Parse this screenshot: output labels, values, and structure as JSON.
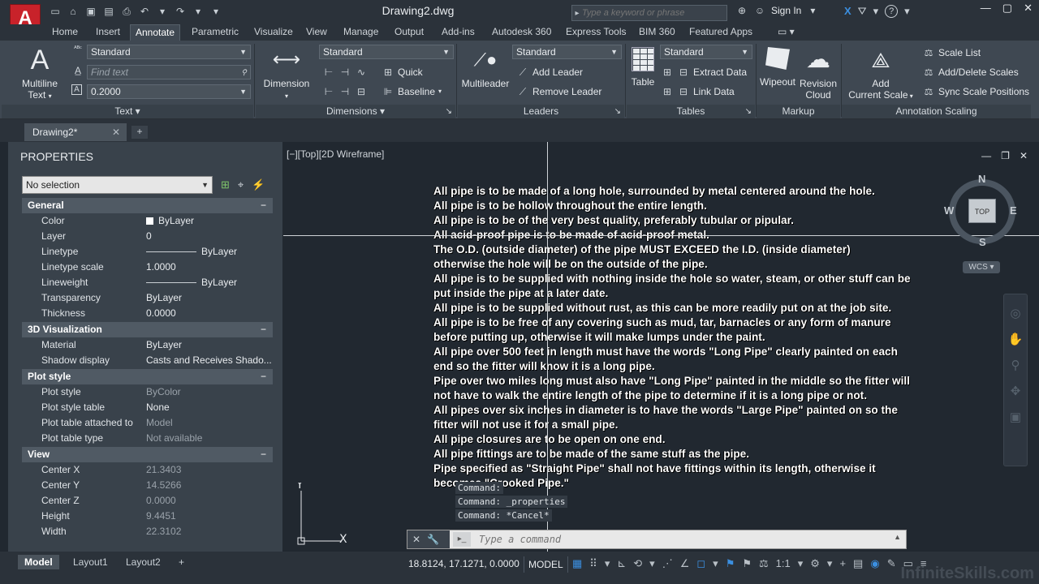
{
  "app": {
    "title": "Drawing2.dwg",
    "logo_letter": "A",
    "search_placeholder": "Type a keyword or phrase",
    "sign_in": "Sign In",
    "help": "?"
  },
  "ribbon_tabs": [
    "Home",
    "Insert",
    "Annotate",
    "Parametric",
    "Visualize",
    "View",
    "Manage",
    "Output",
    "Add-ins",
    "Autodesk 360",
    "Express Tools",
    "BIM 360",
    "Featured Apps"
  ],
  "active_tab": "Annotate",
  "ribbon": {
    "text": {
      "multiline_line1": "Multiline",
      "multiline_line2": "Text",
      "style": "Standard",
      "find_placeholder": "Find text",
      "height": "0.2000",
      "panel_title": "Text"
    },
    "dimensions": {
      "dimension": "Dimension",
      "style": "Standard",
      "quick": "Quick",
      "baseline": "Baseline",
      "panel_title": "Dimensions"
    },
    "leaders": {
      "multileader": "Multileader",
      "style": "Standard",
      "add_leader": "Add Leader",
      "remove_leader": "Remove Leader",
      "panel_title": "Leaders"
    },
    "tables": {
      "table": "Table",
      "style": "Standard",
      "extract_data": "Extract Data",
      "link_data": "Link Data",
      "panel_title": "Tables"
    },
    "markup": {
      "wipeout": "Wipeout",
      "revision_line1": "Revision",
      "revision_line2": "Cloud",
      "panel_title": "Markup"
    },
    "annotation_scaling": {
      "add_line1": "Add",
      "add_line2": "Current Scale",
      "scale_list": "Scale List",
      "add_delete_scales": "Add/Delete Scales",
      "sync_scale_positions": "Sync Scale Positions",
      "panel_title": "Annotation Scaling"
    }
  },
  "doc_tab": {
    "label": "Drawing2*"
  },
  "properties": {
    "title": "PROPERTIES",
    "selection": "No selection",
    "sections": {
      "general": "General",
      "viz3d": "3D Visualization",
      "plot": "Plot style",
      "view": "View"
    },
    "general": [
      {
        "k": "Color",
        "v": "ByLayer"
      },
      {
        "k": "Layer",
        "v": "0"
      },
      {
        "k": "Linetype",
        "v": "ByLayer"
      },
      {
        "k": "Linetype scale",
        "v": "1.0000"
      },
      {
        "k": "Lineweight",
        "v": "ByLayer"
      },
      {
        "k": "Transparency",
        "v": "ByLayer"
      },
      {
        "k": "Thickness",
        "v": "0.0000"
      }
    ],
    "viz3d": [
      {
        "k": "Material",
        "v": "ByLayer"
      },
      {
        "k": "Shadow display",
        "v": "Casts  and  Receives  Shado..."
      }
    ],
    "plot": [
      {
        "k": "Plot style",
        "v": "ByColor"
      },
      {
        "k": "Plot style table",
        "v": "None"
      },
      {
        "k": "Plot table attached to",
        "v": "Model"
      },
      {
        "k": "Plot table type",
        "v": "Not available"
      }
    ],
    "view": [
      {
        "k": "Center X",
        "v": "21.3403"
      },
      {
        "k": "Center Y",
        "v": "14.5266"
      },
      {
        "k": "Center Z",
        "v": "0.0000"
      },
      {
        "k": "Height",
        "v": "9.4451"
      },
      {
        "k": "Width",
        "v": "22.3102"
      }
    ]
  },
  "layout_tabs": [
    "Model",
    "Layout1",
    "Layout2"
  ],
  "viewport": {
    "label": "[−][Top][2D Wireframe]",
    "viewcube": {
      "n": "N",
      "s": "S",
      "e": "E",
      "w": "W",
      "top": "TOP"
    },
    "wcs": "WCS",
    "ucs_x": "X",
    "ucs_y": "Y"
  },
  "mtext_lines": [
    "All pipe is to be made of a long hole, surrounded by metal centered around the hole.",
    "All pipe is to be hollow throughout the entire length.",
    "All pipe is to be of the very best quality, preferably tubular or pipular.",
    "All acid-proof pipe is to be made of acid-proof metal.",
    "The O.D. (outside diameter) of the pipe MUST EXCEED the I.D. (inside diameter)",
    "otherwise the hole will be on the outside of the pipe.",
    "All pipe is to be supplied with nothing inside the hole so water, steam, or other stuff can be",
    "put inside the pipe at a later date.",
    "All pipe is to be supplied without rust, as this can be more readily put on at the job site.",
    "All pipe is to be free of any covering such as mud, tar, barnacles or any form of manure",
    "before putting up, otherwise it will make lumps under the paint.",
    "All pipe over 500 feet in length must have the words \"Long Pipe\" clearly painted on each",
    "end so the fitter will know it is a long pipe.",
    "Pipe over two miles long must also have \"Long Pipe\" painted in the middle so the fitter will",
    "not have to walk the entire length of the pipe to determine if it is a long pipe or not.",
    "All pipes over six inches in diameter is to have the words \"Large Pipe\" painted on so the",
    "fitter will not use it for a small pipe.",
    "All pipe closures are to be open on one end.",
    "All pipe fittings are to be made of the same stuff as the pipe.",
    "Pipe specified as \"Straight Pipe\" shall not have fittings within its length, otherwise it",
    "becomes \"Crooked Pipe.\""
  ],
  "command_history": [
    "Command:",
    "Command: _properties",
    "Command: *Cancel*"
  ],
  "command_placeholder": "Type a command",
  "status": {
    "coords": "18.8124, 17.1271, 0.0000",
    "model": "MODEL",
    "scale": "1:1"
  },
  "watermark": "InfiniteSkills.com"
}
